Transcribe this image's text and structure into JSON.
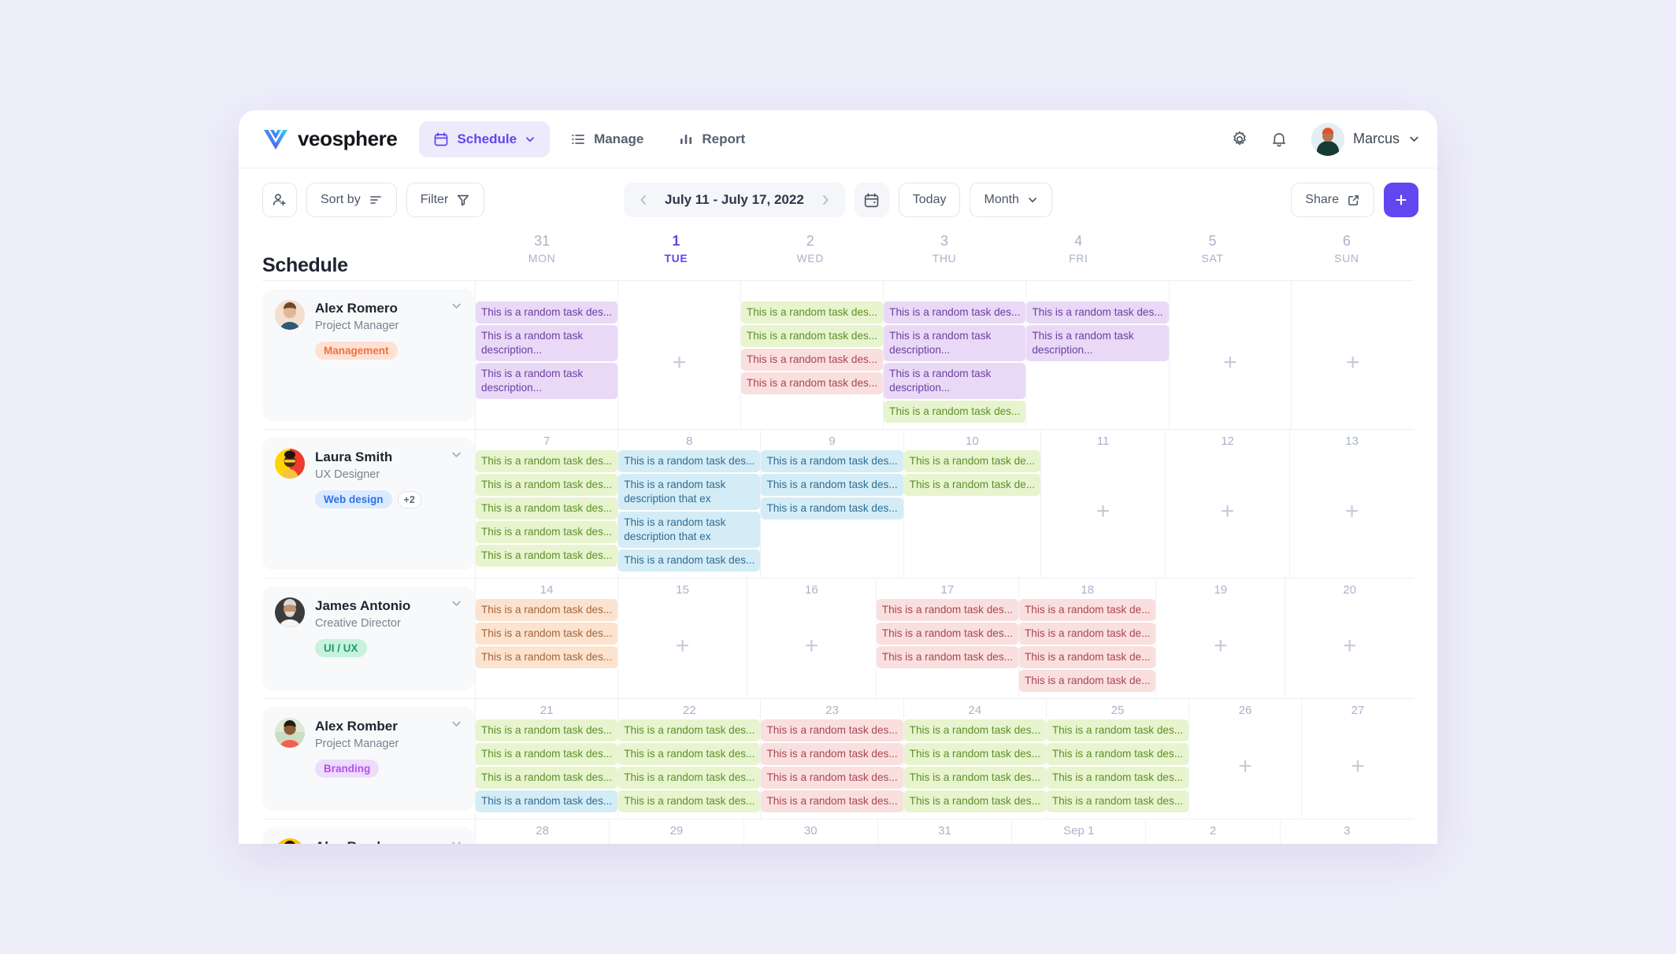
{
  "header": {
    "brand": "veosphere",
    "nav": [
      {
        "label": "Schedule",
        "icon": "calendar-icon",
        "active": true,
        "chevron": true
      },
      {
        "label": "Manage",
        "icon": "list-icon",
        "active": false,
        "chevron": false
      },
      {
        "label": "Report",
        "icon": "bar-chart-icon",
        "active": false,
        "chevron": false
      }
    ],
    "settings_icon": "gear-icon",
    "notifications_icon": "bell-icon",
    "user_name": "Marcus",
    "accent": "#6246f0"
  },
  "toolbar": {
    "add_person_icon": "add-person-icon",
    "sort_label": "Sort by",
    "filter_label": "Filter",
    "date_range": "July 11 - July 17, 2022",
    "prev_icon": "chevron-left-icon",
    "next_icon": "chevron-right-icon",
    "calendar_icon": "calendar-icon",
    "today_label": "Today",
    "view_label": "Month",
    "share_label": "Share",
    "add_label": "+"
  },
  "calendar": {
    "title": "Schedule",
    "days": [
      {
        "num": "31",
        "dow": "MON",
        "today": false
      },
      {
        "num": "1",
        "dow": "TUE",
        "today": true
      },
      {
        "num": "2",
        "dow": "WED",
        "today": false
      },
      {
        "num": "3",
        "dow": "THU",
        "today": false
      },
      {
        "num": "4",
        "dow": "FRI",
        "today": false
      },
      {
        "num": "5",
        "dow": "SAT",
        "today": false
      },
      {
        "num": "6",
        "dow": "SUN",
        "today": false
      }
    ],
    "task_short": "This is a random task des...",
    "task_short2": "This is a random task de...",
    "task_long": "This is a random task description...",
    "task_long2": "This is a random task description that ex",
    "rows": [
      {
        "name": "Alex Romero",
        "role": "Project Manager",
        "tags": [
          {
            "label": "Management",
            "bg": "#ffe1d4",
            "fg": "#f2703c"
          }
        ],
        "more": null,
        "avatar": "alex-romero-avatar",
        "cells": [
          {
            "daynum": "",
            "cards": [
              {
                "color": "c-purple",
                "text": "task_short",
                "lines": 1
              },
              {
                "color": "c-purple",
                "text": "task_long",
                "lines": 2
              },
              {
                "color": "c-purple",
                "text": "task_long",
                "lines": 2
              }
            ]
          },
          {
            "daynum": "",
            "cards": []
          },
          {
            "daynum": "",
            "cards": [
              {
                "color": "c-green",
                "text": "task_short",
                "lines": 1
              },
              {
                "color": "c-green",
                "text": "task_short",
                "lines": 1
              },
              {
                "color": "c-red",
                "text": "task_short",
                "lines": 1
              },
              {
                "color": "c-red",
                "text": "task_short",
                "lines": 1
              }
            ]
          },
          {
            "daynum": "",
            "cards": [
              {
                "color": "c-purple",
                "text": "task_short",
                "lines": 1
              },
              {
                "color": "c-purple",
                "text": "task_long",
                "lines": 2
              },
              {
                "color": "c-purple",
                "text": "task_long",
                "lines": 2
              },
              {
                "color": "c-green",
                "text": "task_short",
                "lines": 1
              }
            ]
          },
          {
            "daynum": "",
            "cards": [
              {
                "color": "c-purple",
                "text": "task_short",
                "lines": 1
              },
              {
                "color": "c-purple",
                "text": "task_long",
                "lines": 2
              }
            ]
          },
          {
            "daynum": "",
            "cards": []
          },
          {
            "daynum": "",
            "cards": []
          }
        ]
      },
      {
        "name": "Laura Smith",
        "role": "UX Designer",
        "tags": [
          {
            "label": "Web design",
            "bg": "#dbeafe",
            "fg": "#2f72e8"
          }
        ],
        "more": "+2",
        "avatar": "laura-smith-avatar",
        "cells": [
          {
            "daynum": "7",
            "cards": [
              {
                "color": "c-green",
                "text": "task_short",
                "lines": 1
              },
              {
                "color": "c-green",
                "text": "task_short",
                "lines": 1
              },
              {
                "color": "c-green",
                "text": "task_short",
                "lines": 1
              },
              {
                "color": "c-green",
                "text": "task_short",
                "lines": 1
              },
              {
                "color": "c-green",
                "text": "task_short",
                "lines": 1
              }
            ]
          },
          {
            "daynum": "8",
            "cards": [
              {
                "color": "c-blue",
                "text": "task_short",
                "lines": 1
              },
              {
                "color": "c-blue",
                "text": "task_long2",
                "lines": 2
              },
              {
                "color": "c-blue",
                "text": "task_long2",
                "lines": 2
              },
              {
                "color": "c-blue",
                "text": "task_short",
                "lines": 1
              }
            ]
          },
          {
            "daynum": "9",
            "cards": [
              {
                "color": "c-blue",
                "text": "task_short",
                "lines": 1
              },
              {
                "color": "c-blue",
                "text": "task_short",
                "lines": 1
              },
              {
                "color": "c-blue",
                "text": "task_short",
                "lines": 1
              }
            ]
          },
          {
            "daynum": "10",
            "cards": [
              {
                "color": "c-green",
                "text": "task_short2",
                "lines": 1
              },
              {
                "color": "c-green",
                "text": "task_short2",
                "lines": 1
              }
            ]
          },
          {
            "daynum": "11",
            "cards": []
          },
          {
            "daynum": "12",
            "cards": []
          },
          {
            "daynum": "13",
            "cards": []
          }
        ]
      },
      {
        "name": "James Antonio",
        "role": "Creative Director",
        "tags": [
          {
            "label": "UI / UX",
            "bg": "#c8f2dd",
            "fg": "#1aa06a"
          }
        ],
        "more": null,
        "avatar": "james-antonio-avatar",
        "cells": [
          {
            "daynum": "14",
            "cards": [
              {
                "color": "c-orange",
                "text": "task_short",
                "lines": 1
              },
              {
                "color": "c-orange",
                "text": "task_short",
                "lines": 1
              },
              {
                "color": "c-orange",
                "text": "task_short",
                "lines": 1
              }
            ]
          },
          {
            "daynum": "15",
            "cards": []
          },
          {
            "daynum": "16",
            "cards": []
          },
          {
            "daynum": "17",
            "cards": [
              {
                "color": "c-red",
                "text": "task_short",
                "lines": 1
              },
              {
                "color": "c-red",
                "text": "task_short",
                "lines": 1
              },
              {
                "color": "c-red",
                "text": "task_short",
                "lines": 2
              }
            ]
          },
          {
            "daynum": "18",
            "cards": [
              {
                "color": "c-red",
                "text": "task_short2",
                "lines": 1
              },
              {
                "color": "c-red",
                "text": "task_short2",
                "lines": 1
              },
              {
                "color": "c-red",
                "text": "task_short2",
                "lines": 1
              },
              {
                "color": "c-red",
                "text": "task_short2",
                "lines": 1
              }
            ]
          },
          {
            "daynum": "19",
            "cards": []
          },
          {
            "daynum": "20",
            "cards": []
          }
        ]
      },
      {
        "name": "Alex Romber",
        "role": "Project Manager",
        "tags": [
          {
            "label": "Branding",
            "bg": "#eedcfb",
            "fg": "#b24ff0"
          }
        ],
        "more": null,
        "avatar": "alex-romber-avatar",
        "cells": [
          {
            "daynum": "21",
            "cards": [
              {
                "color": "c-green",
                "text": "task_short",
                "lines": 1
              },
              {
                "color": "c-green",
                "text": "task_short",
                "lines": 1
              },
              {
                "color": "c-green",
                "text": "task_short",
                "lines": 1
              },
              {
                "color": "c-blue",
                "text": "task_short",
                "lines": 1
              }
            ]
          },
          {
            "daynum": "22",
            "cards": [
              {
                "color": "c-green",
                "text": "task_short",
                "lines": 1
              },
              {
                "color": "c-green",
                "text": "task_short",
                "lines": 1
              },
              {
                "color": "c-green",
                "text": "task_short",
                "lines": 1
              },
              {
                "color": "c-green",
                "text": "task_short",
                "lines": 1
              }
            ]
          },
          {
            "daynum": "23",
            "cards": [
              {
                "color": "c-red",
                "text": "task_short",
                "lines": 1
              },
              {
                "color": "c-red",
                "text": "task_short",
                "lines": 1
              },
              {
                "color": "c-red",
                "text": "task_short",
                "lines": 1
              },
              {
                "color": "c-red",
                "text": "task_short",
                "lines": 1
              }
            ]
          },
          {
            "daynum": "24",
            "cards": [
              {
                "color": "c-green",
                "text": "task_short",
                "lines": 1
              },
              {
                "color": "c-green",
                "text": "task_short",
                "lines": 1
              },
              {
                "color": "c-green",
                "text": "task_short",
                "lines": 1
              },
              {
                "color": "c-green",
                "text": "task_short",
                "lines": 1
              }
            ]
          },
          {
            "daynum": "25",
            "cards": [
              {
                "color": "c-green",
                "text": "task_short",
                "lines": 1
              },
              {
                "color": "c-green",
                "text": "task_short",
                "lines": 1
              },
              {
                "color": "c-green",
                "text": "task_short",
                "lines": 1
              },
              {
                "color": "c-green",
                "text": "task_short",
                "lines": 1
              }
            ]
          },
          {
            "daynum": "26",
            "cards": []
          },
          {
            "daynum": "27",
            "cards": []
          }
        ]
      },
      {
        "name": "Alex Romber",
        "role": "",
        "tags": [],
        "more": null,
        "avatar": "alex-romber-avatar-2",
        "cells": [
          {
            "daynum": "28",
            "cards": []
          },
          {
            "daynum": "29",
            "cards": []
          },
          {
            "daynum": "30",
            "cards": []
          },
          {
            "daynum": "31",
            "cards": []
          },
          {
            "daynum": "Sep 1",
            "cards": []
          },
          {
            "daynum": "2",
            "cards": []
          },
          {
            "daynum": "3",
            "cards": []
          }
        ]
      }
    ]
  }
}
